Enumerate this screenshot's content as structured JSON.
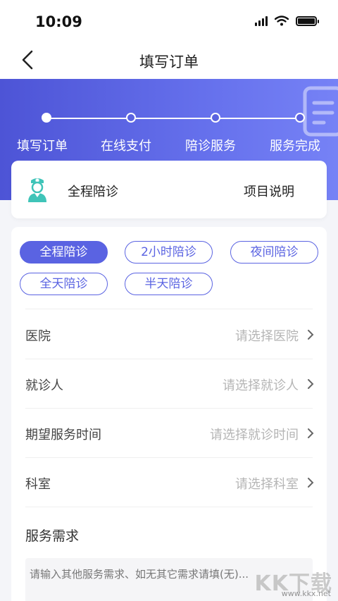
{
  "status_bar": {
    "time": "10:09"
  },
  "nav": {
    "title": "填写订单"
  },
  "progress": {
    "steps": [
      "填写订单",
      "在线支付",
      "陪诊服务",
      "服务完成"
    ],
    "current_step": 1
  },
  "service": {
    "name": "全程陪诊",
    "link": "项目说明"
  },
  "service_options": {
    "selected": "全程陪诊",
    "items": [
      "全程陪诊",
      "2小时陪诊",
      "夜间陪诊",
      "全天陪诊",
      "半天陪诊"
    ]
  },
  "form": {
    "hospital": {
      "label": "医院",
      "placeholder": "请选择医院"
    },
    "patient": {
      "label": "就诊人",
      "placeholder": "请选择就诊人"
    },
    "time": {
      "label": "期望服务时间",
      "placeholder": "请选择就诊时间"
    },
    "department": {
      "label": "科室",
      "placeholder": "请选择科室"
    },
    "requirements": {
      "label": "服务需求",
      "placeholder": "请输入其他服务需求、如无其它需求请填(无)..."
    }
  },
  "watermark": {
    "logo": "KK下载",
    "url": "www.kkx.net"
  },
  "colors": {
    "primary": "#5a63e2",
    "banner_start": "#4d54d6",
    "banner_end": "#7682f6",
    "nurse_icon": "#3fc4b8"
  }
}
